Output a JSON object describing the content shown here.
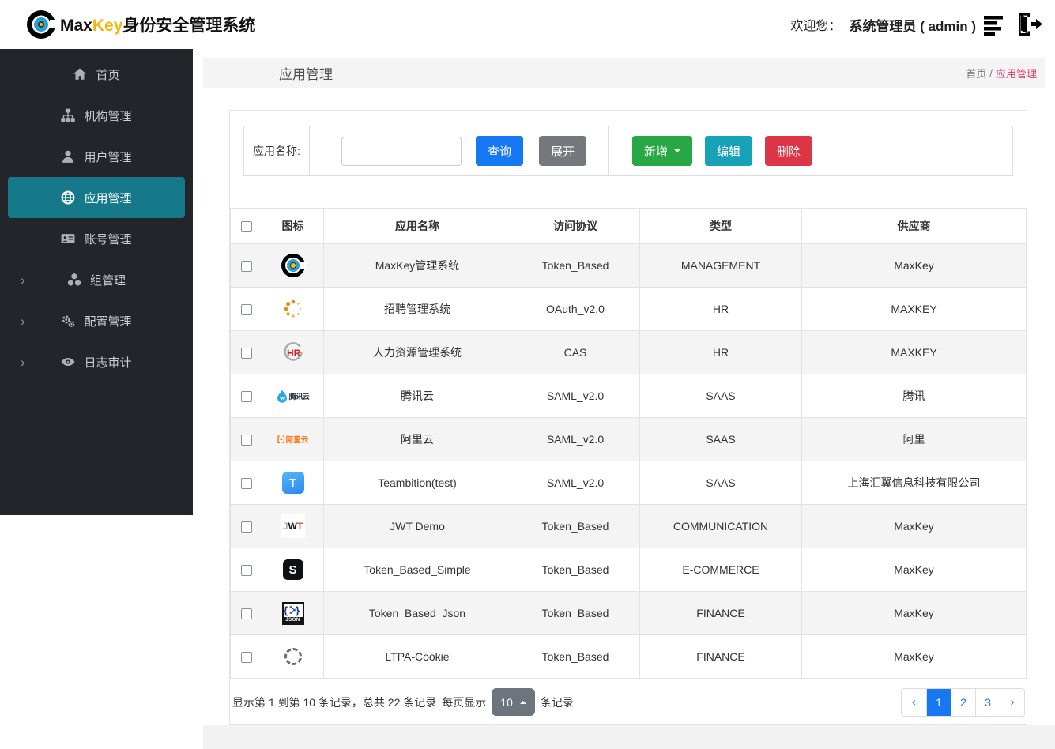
{
  "header": {
    "brand": {
      "max": "Max",
      "key": "Key",
      "suffix": "身份安全管理系统"
    },
    "welcome_label": "欢迎您：",
    "username": "系统管理员 ( admin )"
  },
  "sidebar": {
    "items": [
      {
        "id": "home",
        "label": "首页",
        "icon": "home-icon",
        "active": false,
        "chevron": false
      },
      {
        "id": "org",
        "label": "机构管理",
        "icon": "sitemap-icon",
        "active": false,
        "chevron": false
      },
      {
        "id": "user",
        "label": "用户管理",
        "icon": "user-icon",
        "active": false,
        "chevron": false
      },
      {
        "id": "app",
        "label": "应用管理",
        "icon": "globe-icon",
        "active": true,
        "chevron": false
      },
      {
        "id": "account",
        "label": "账号管理",
        "icon": "id-card-icon",
        "active": false,
        "chevron": false
      },
      {
        "id": "group",
        "label": "组管理",
        "icon": "cubes-icon",
        "active": false,
        "chevron": true
      },
      {
        "id": "config",
        "label": "配置管理",
        "icon": "gears-icon",
        "active": false,
        "chevron": true
      },
      {
        "id": "log",
        "label": "日志审计",
        "icon": "eye-icon",
        "active": false,
        "chevron": true
      }
    ]
  },
  "page": {
    "title": "应用管理",
    "breadcrumb": {
      "home": "首页",
      "separator": "/",
      "current": "应用管理"
    }
  },
  "toolbar": {
    "search_label": "应用名称:",
    "search_value": "",
    "query_label": "查询",
    "expand_label": "展开",
    "add_label": "新增",
    "edit_label": "编辑",
    "delete_label": "删除"
  },
  "table": {
    "headers": [
      "图标",
      "应用名称",
      "访问协议",
      "类型",
      "供应商"
    ],
    "rows": [
      {
        "icon": "maxkey-app-icon",
        "name": "MaxKey管理系统",
        "protocol": "Token_Based",
        "category": "MANAGEMENT",
        "vendor": "MaxKey"
      },
      {
        "icon": "spinner-dots-icon",
        "name": "招聘管理系统",
        "protocol": "OAuth_v2.0",
        "category": "HR",
        "vendor": "MAXKEY"
      },
      {
        "icon": "hr-logo-icon",
        "name": "人力资源管理系统",
        "protocol": "CAS",
        "category": "HR",
        "vendor": "MAXKEY"
      },
      {
        "icon": "tencent-cloud-icon",
        "name": "腾讯云",
        "protocol": "SAML_v2.0",
        "category": "SAAS",
        "vendor": "腾讯"
      },
      {
        "icon": "aliyun-icon",
        "name": "阿里云",
        "protocol": "SAML_v2.0",
        "category": "SAAS",
        "vendor": "阿里"
      },
      {
        "icon": "teambition-icon",
        "name": "Teambition(test)",
        "protocol": "SAML_v2.0",
        "category": "SAAS",
        "vendor": "上海汇翼信息科技有限公司"
      },
      {
        "icon": "jwt-icon",
        "name": "JWT Demo",
        "protocol": "Token_Based",
        "category": "COMMUNICATION",
        "vendor": "MaxKey"
      },
      {
        "icon": "s-logo-icon",
        "name": "Token_Based_Simple",
        "protocol": "Token_Based",
        "category": "E-COMMERCE",
        "vendor": "MaxKey"
      },
      {
        "icon": "json-logo-icon",
        "name": "Token_Based_Json",
        "protocol": "Token_Based",
        "category": "FINANCE",
        "vendor": "MaxKey"
      },
      {
        "icon": "target-circle-icon",
        "name": "LTPA-Cookie",
        "protocol": "Token_Based",
        "category": "FINANCE",
        "vendor": "MaxKey"
      }
    ]
  },
  "icons": {
    "hr_text": "HR",
    "tencent_text": "腾讯云",
    "aliyun_bracket": "[-]",
    "aliyun_text": "阿里云",
    "teambition_letter": "T",
    "jwt_letters": [
      "J",
      "W",
      "T"
    ],
    "s_letter": "S",
    "json_label": "JSON"
  },
  "pagination": {
    "info_prefix": "显示第 1 到第 10 条记录，总共 22 条记录",
    "per_page_label": "每页显示",
    "page_size": "10",
    "info_suffix": "条记录",
    "prev": "‹",
    "next": "›",
    "pages": [
      "1",
      "2",
      "3"
    ],
    "active_page": "1"
  },
  "colors": {
    "primary_blue": "#1678f2",
    "success_green": "#28a745",
    "info_teal": "#17a2b8",
    "danger_red": "#dc3545",
    "active_menu_teal": "#15798b",
    "breadcrumb_pink": "#e8386d",
    "brand_yellow": "#f5b50a",
    "sidebar_dark": "#22262b"
  }
}
